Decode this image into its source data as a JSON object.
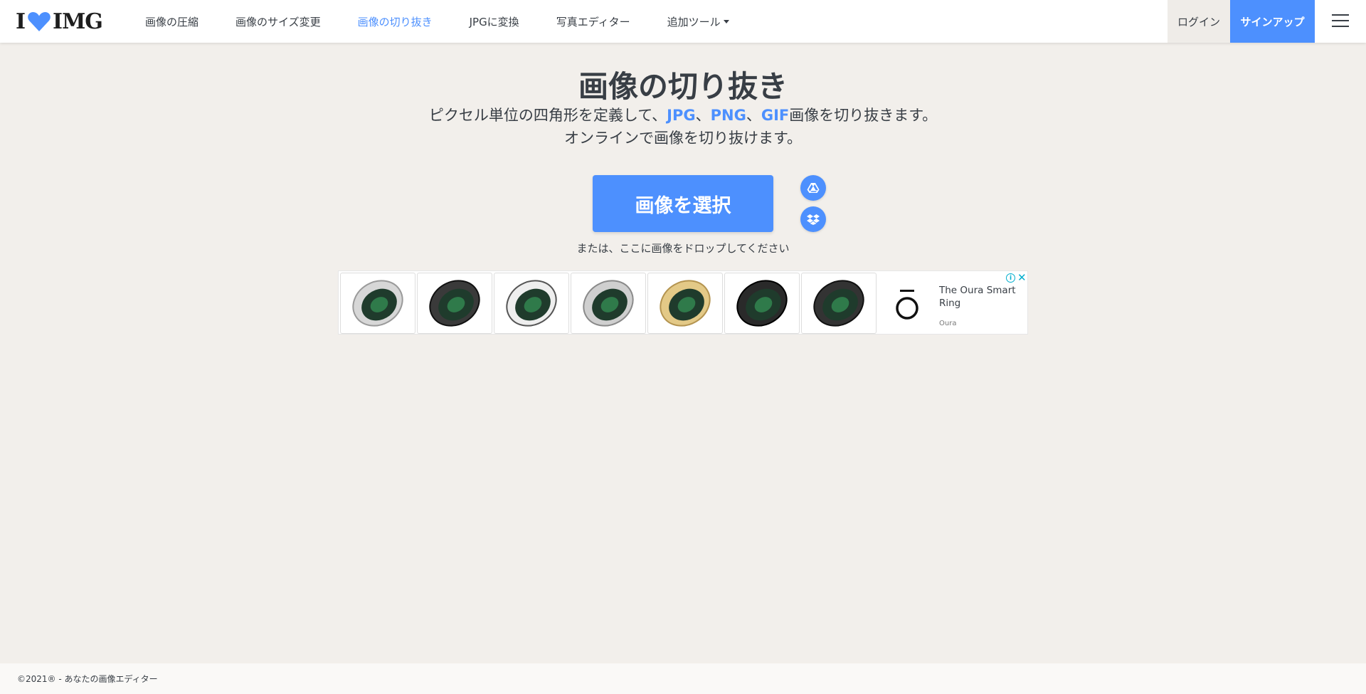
{
  "header": {
    "logo_left": "I",
    "logo_right": "IMG",
    "nav": [
      {
        "label": "画像の圧縮"
      },
      {
        "label": "画像のサイズ変更"
      },
      {
        "label": "画像の切り抜き"
      },
      {
        "label": "JPGに変換"
      },
      {
        "label": "写真エディター"
      },
      {
        "label": "追加ツール"
      }
    ],
    "active_index": 2,
    "login_label": "ログイン",
    "signup_label": "サインアップ"
  },
  "main": {
    "title": "画像の切り抜き",
    "subtitle_prefix": "ピクセル単位の四角形を定義して、",
    "format_jpg": "JPG",
    "sep1": "、",
    "format_png": "PNG",
    "sep2": "、",
    "format_gif": "GIF",
    "subtitle_suffix": "画像を切り抜きます。",
    "subtitle_line2": "オンラインで画像を切り抜けます。",
    "select_button": "画像を選択",
    "drop_hint": "または、ここに画像をドロップしてください"
  },
  "ad": {
    "headline": "The Oura Smart Ring",
    "brand": "Oura",
    "info_glyph": "i",
    "close_glyph": "✕",
    "ring_colors": [
      "silver",
      "black",
      "silver",
      "silver",
      "gold",
      "black",
      "black"
    ]
  },
  "footer": {
    "text": "©2021® - あなたの画像エディター"
  },
  "colors": {
    "accent": "#4d90fe",
    "background": "#f2efeb",
    "text": "#383e45"
  },
  "icons": {
    "drive": "google-drive-icon",
    "dropbox": "dropbox-icon",
    "menu": "hamburger-menu-icon"
  }
}
